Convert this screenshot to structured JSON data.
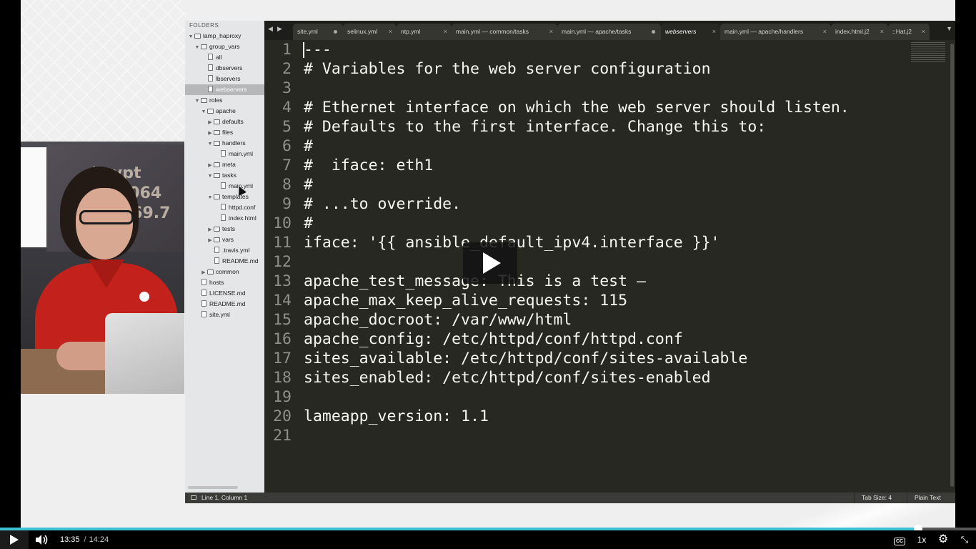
{
  "sidebar": {
    "header": "FOLDERS",
    "items": [
      {
        "label": "lamp_haproxy",
        "type": "folder",
        "expanded": true,
        "depth": 0
      },
      {
        "label": "group_vars",
        "type": "folder",
        "expanded": true,
        "depth": 1
      },
      {
        "label": "all",
        "type": "file",
        "depth": 2
      },
      {
        "label": "dbservers",
        "type": "file",
        "depth": 2
      },
      {
        "label": "lbservers",
        "type": "file",
        "depth": 2
      },
      {
        "label": "webservers",
        "type": "file",
        "depth": 2,
        "selected": true
      },
      {
        "label": "roles",
        "type": "folder",
        "expanded": true,
        "depth": 1
      },
      {
        "label": "apache",
        "type": "folder",
        "expanded": true,
        "depth": 2
      },
      {
        "label": "defaults",
        "type": "folder",
        "expanded": false,
        "depth": 3
      },
      {
        "label": "files",
        "type": "folder",
        "expanded": false,
        "depth": 3
      },
      {
        "label": "handlers",
        "type": "folder",
        "expanded": true,
        "depth": 3
      },
      {
        "label": "main.yml",
        "type": "file",
        "depth": 4
      },
      {
        "label": "meta",
        "type": "folder",
        "expanded": false,
        "depth": 3
      },
      {
        "label": "tasks",
        "type": "folder",
        "expanded": true,
        "depth": 3
      },
      {
        "label": "main.yml",
        "type": "file",
        "depth": 4
      },
      {
        "label": "templates",
        "type": "folder",
        "expanded": true,
        "depth": 3
      },
      {
        "label": "httpd.conf",
        "type": "file",
        "depth": 4
      },
      {
        "label": "index.html",
        "type": "file",
        "depth": 4
      },
      {
        "label": "tests",
        "type": "folder",
        "expanded": false,
        "depth": 3
      },
      {
        "label": "vars",
        "type": "folder",
        "expanded": false,
        "depth": 3
      },
      {
        "label": ".travis.yml",
        "type": "file",
        "depth": 3
      },
      {
        "label": "README.md",
        "type": "file",
        "depth": 3
      },
      {
        "label": "common",
        "type": "folder",
        "expanded": false,
        "depth": 2
      },
      {
        "label": "hosts",
        "type": "file",
        "depth": 1
      },
      {
        "label": "LICENSE.md",
        "type": "file",
        "depth": 1
      },
      {
        "label": "README.md",
        "type": "file",
        "depth": 1
      },
      {
        "label": "site.yml",
        "type": "file",
        "depth": 1
      }
    ]
  },
  "tabs": [
    {
      "label": "site.yml",
      "state": "dirty"
    },
    {
      "label": "selinux.yml",
      "state": "close"
    },
    {
      "label": "ntp.yml",
      "state": "close"
    },
    {
      "label": "main.yml — common/tasks",
      "state": "close"
    },
    {
      "label": "main.yml — apache/tasks",
      "state": "dirty"
    },
    {
      "label": "webservers",
      "state": "close",
      "active": true
    },
    {
      "label": "main.yml — apache/handlers",
      "state": "close"
    },
    {
      "label": "index.html.j2",
      "state": "close"
    },
    {
      "label": "::Hat.j2",
      "state": "close"
    }
  ],
  "tab_nav": {
    "prev": "◀",
    "next": "▶",
    "overflow": "▼",
    "close": "×"
  },
  "code_lines": [
    {
      "n": "1",
      "text": "---"
    },
    {
      "n": "2",
      "text": "# Variables for the web server configuration"
    },
    {
      "n": "3",
      "text": ""
    },
    {
      "n": "4",
      "text": "# Ethernet interface on which the web server should listen."
    },
    {
      "n": "5",
      "text": "# Defaults to the first interface. Change this to:"
    },
    {
      "n": "6",
      "text": "#"
    },
    {
      "n": "7",
      "text": "#  iface: eth1"
    },
    {
      "n": "8",
      "text": "#"
    },
    {
      "n": "9",
      "text": "# ...to override."
    },
    {
      "n": "10",
      "text": "#"
    },
    {
      "n": "11",
      "text": "iface: '{{ ansible_default_ipv4.interface }}'"
    },
    {
      "n": "12",
      "text": ""
    },
    {
      "n": "13",
      "text": "apache_test_message: This is a test —"
    },
    {
      "n": "14",
      "text": "apache_max_keep_alive_requests: 115"
    },
    {
      "n": "15",
      "text": "apache_docroot: /var/www/html"
    },
    {
      "n": "16",
      "text": "apache_config: /etc/httpd/conf/httpd.conf"
    },
    {
      "n": "17",
      "text": "sites_available: /etc/httpd/conf/sites-available"
    },
    {
      "n": "18",
      "text": "sites_enabled: /etc/httpd/conf/sites-enabled"
    },
    {
      "n": "19",
      "text": ""
    },
    {
      "n": "20",
      "text": "lameapp_version: 1.1"
    },
    {
      "n": "21",
      "text": ""
    }
  ],
  "statusbar": {
    "position": "Line 1, Column 1",
    "tab_size": "Tab Size: 4",
    "syntax": "Plain Text"
  },
  "player": {
    "current_time": "13:35",
    "separator": "/",
    "duration": "14:24",
    "progress_fraction": 0.941,
    "speed": "1x",
    "cc_label": "CC",
    "settings_icon": "⚙",
    "fullscreen_icon": "⤡",
    "accent_color": "#3ec1d3"
  },
  "colors": {
    "editor_bg": "#272822",
    "sidebar_bg": "#e5e6e7",
    "presenter_shirt": "#c2221b"
  }
}
